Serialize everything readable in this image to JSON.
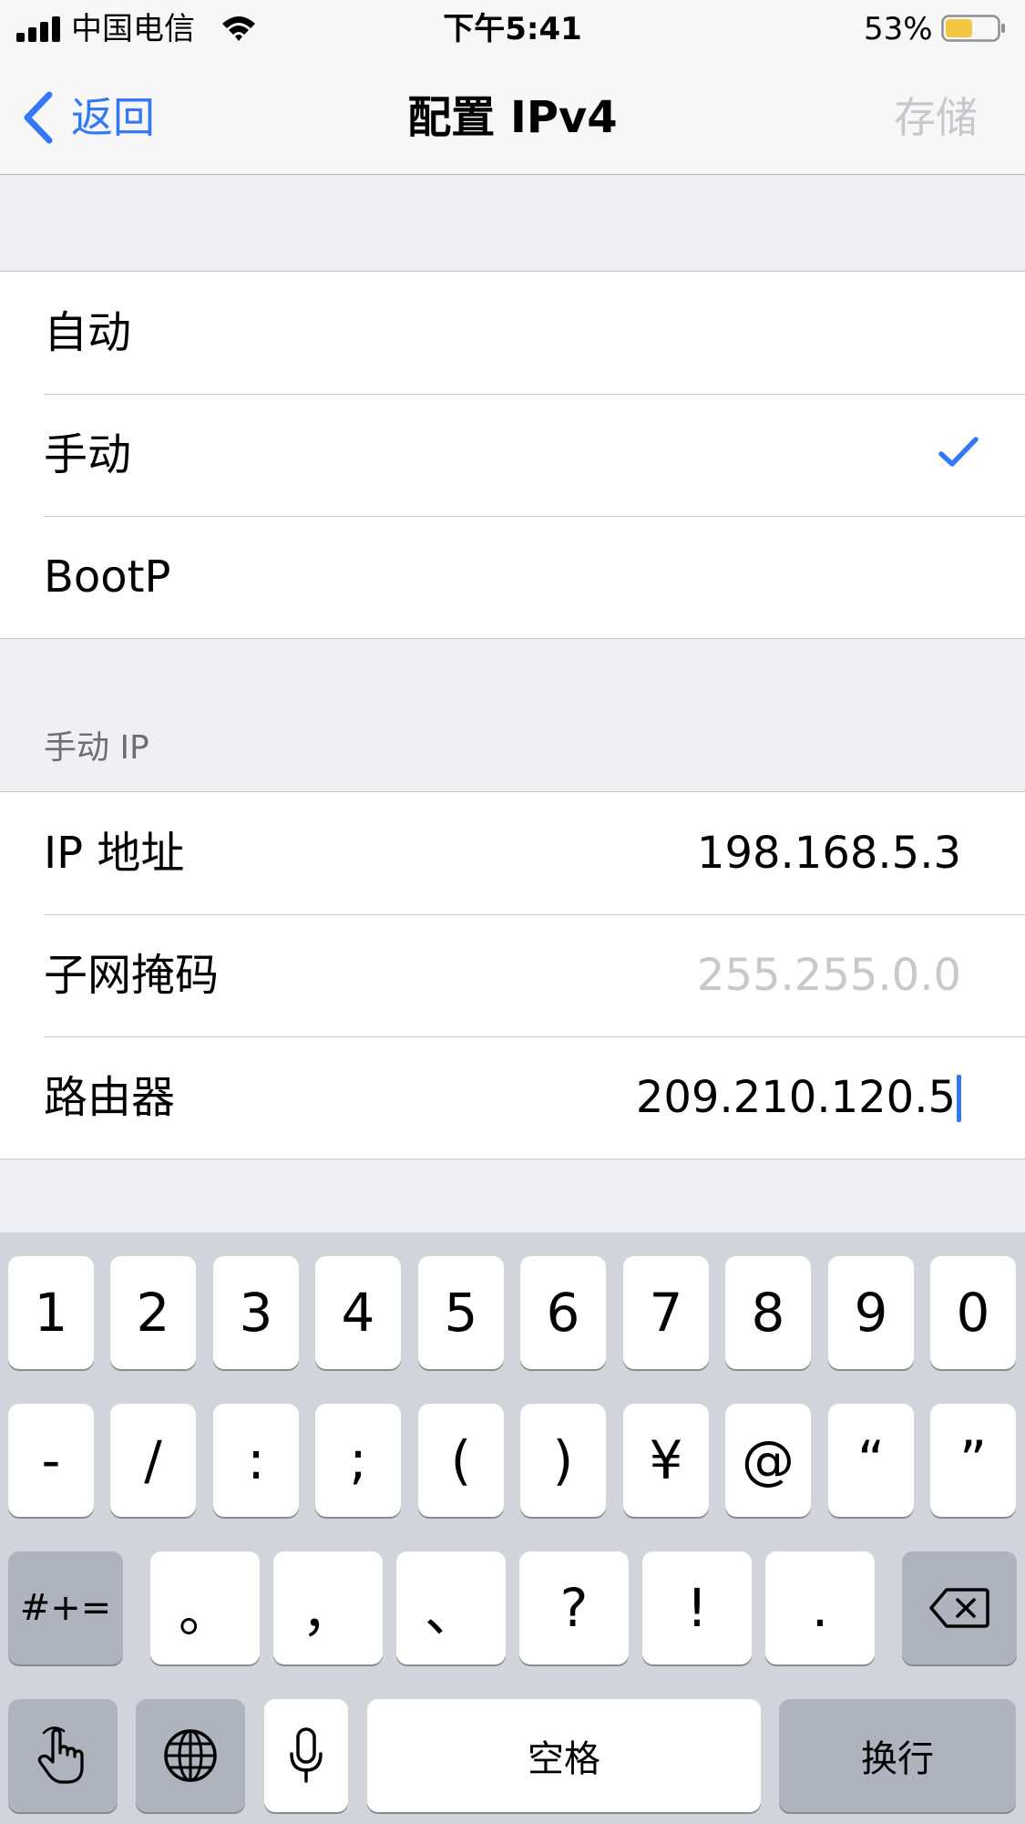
{
  "status_bar": {
    "carrier": "中国电信",
    "time": "下午5:41",
    "battery_percent": "53%",
    "battery_level": 0.53,
    "battery_color": "#f5c544"
  },
  "nav": {
    "back_label": "返回",
    "title": "配置 IPv4",
    "save_label": "存储",
    "accent_color": "#3478f6"
  },
  "mode_options": [
    {
      "label": "自动",
      "selected": false
    },
    {
      "label": "手动",
      "selected": true
    },
    {
      "label": "BootP",
      "selected": false
    }
  ],
  "manual_ip": {
    "section_header": "手动 IP",
    "fields": [
      {
        "label": "IP 地址",
        "value": "198.168.5.3",
        "placeholder": ""
      },
      {
        "label": "子网掩码",
        "value": "",
        "placeholder": "255.255.0.0"
      },
      {
        "label": "路由器",
        "value": "209.210.120.5",
        "placeholder": ""
      }
    ]
  },
  "keyboard": {
    "row1": [
      "1",
      "2",
      "3",
      "4",
      "5",
      "6",
      "7",
      "8",
      "9",
      "0"
    ],
    "row2": [
      "-",
      "/",
      ":",
      ";",
      "(",
      ")",
      "¥",
      "@",
      "“",
      "”"
    ],
    "row3": [
      "#+=",
      "。",
      "，",
      "、",
      "?",
      "!",
      "."
    ],
    "space_label": "空格",
    "return_label": "换行",
    "icons": [
      "delete-icon",
      "hand-icon",
      "globe-icon",
      "microphone-icon"
    ]
  }
}
